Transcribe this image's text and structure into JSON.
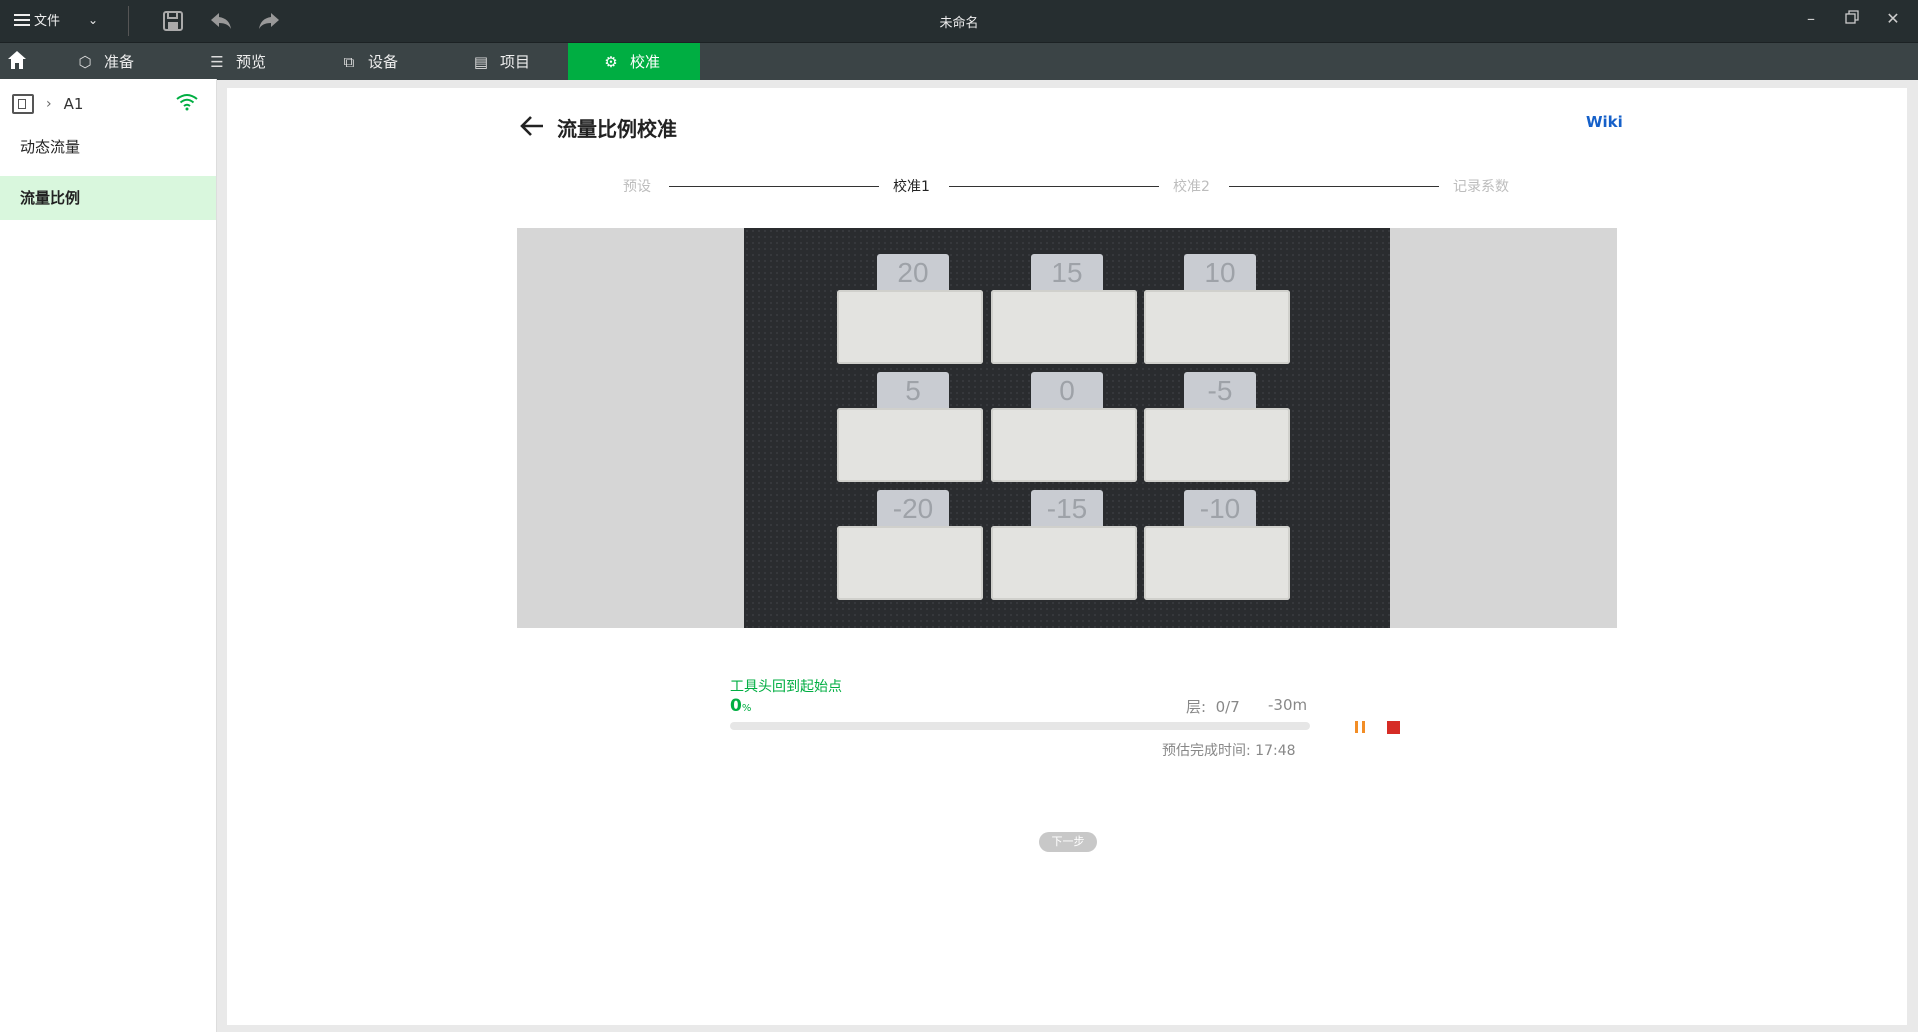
{
  "titlebar": {
    "file_label": "文件",
    "window_title": "未命名",
    "icons": [
      "menu-icon",
      "chevron-down-icon",
      "save-icon",
      "undo-icon",
      "redo-icon",
      "minimize-icon",
      "restore-icon",
      "close-icon"
    ]
  },
  "tabs": [
    {
      "label": "准备",
      "icon": "cube-icon"
    },
    {
      "label": "预览",
      "icon": "layers-icon"
    },
    {
      "label": "设备",
      "icon": "device-icon"
    },
    {
      "label": "项目",
      "icon": "list-icon"
    },
    {
      "label": "校准",
      "icon": "gear-icon",
      "active": true
    }
  ],
  "sidebar": {
    "device_name": "A1",
    "items": [
      {
        "label": "动态流量"
      },
      {
        "label": "流量比例",
        "active": true
      }
    ]
  },
  "main": {
    "title": "流量比例校准",
    "wiki_label": "Wiki",
    "steps": [
      "预设",
      "校准1",
      "校准2",
      "记录系数"
    ],
    "current_step": "校准1",
    "tiles": [
      "20",
      "15",
      "10",
      "5",
      "0",
      "-5",
      "-20",
      "-15",
      "-10"
    ],
    "progress": {
      "status": "工具头回到起始点",
      "percent": "0",
      "percent_unit": "%",
      "layer_label": "层:",
      "layer_value": "0/7",
      "remaining": "-30m",
      "eta_label": "预估完成时间:",
      "eta_value": "17:48",
      "fraction": 0
    },
    "next_label": "下一步"
  },
  "colors": {
    "accent": "#00ae42",
    "titlebar_bg": "#262e30",
    "tabbar_bg": "#3b4446",
    "wiki": "#1560c9",
    "pause": "#f28d26",
    "stop": "#d62c25"
  }
}
